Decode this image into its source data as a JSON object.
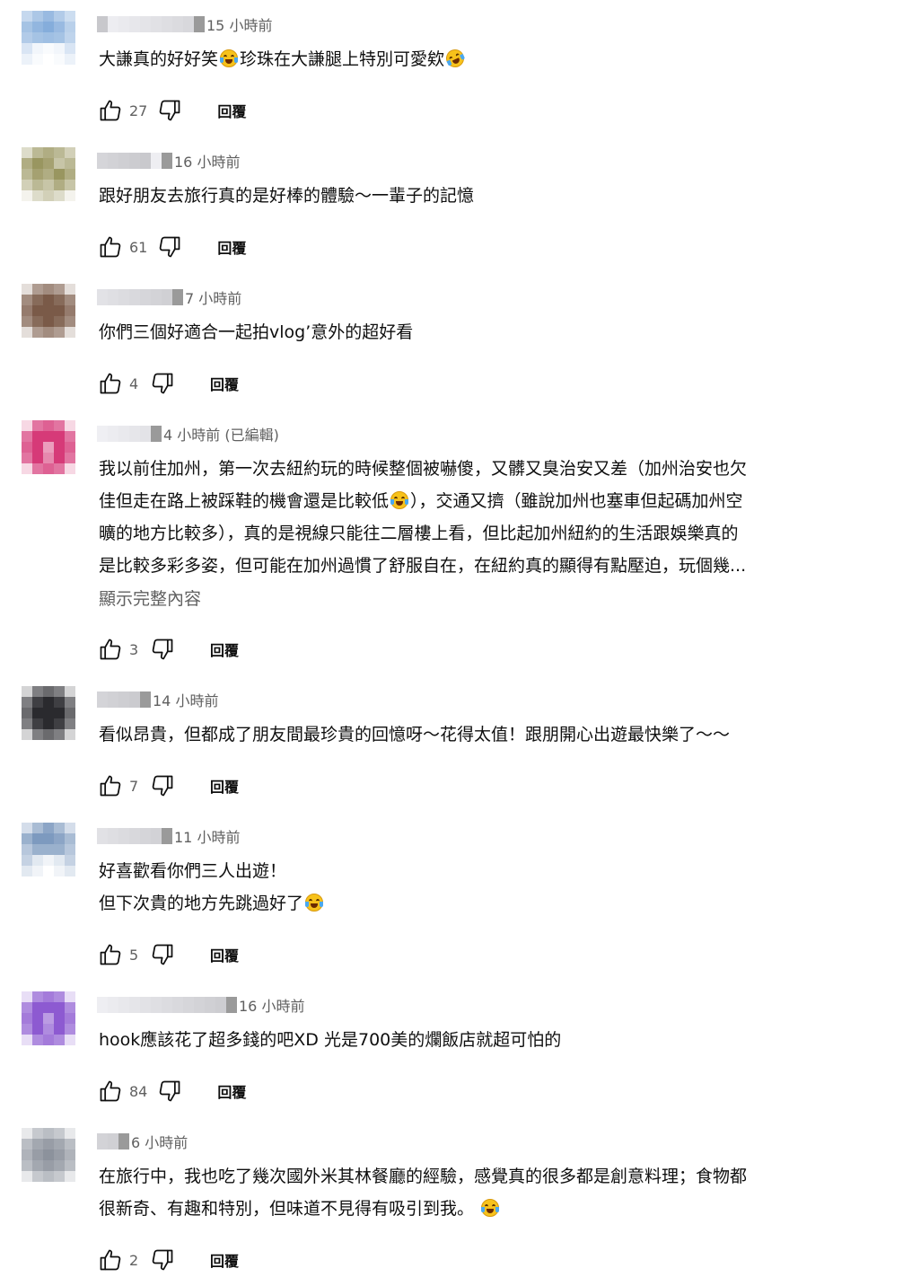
{
  "comments": [
    {
      "time": "15 小時前",
      "parts": [
        {
          "t": "text",
          "v": "大謙真的好好笑"
        },
        {
          "t": "emoji",
          "v": "joy"
        },
        {
          "t": "text",
          "v": "珍珠在大謙腿上特別可愛欸"
        },
        {
          "t": "emoji",
          "v": "rofl"
        }
      ],
      "likes": "27",
      "reply_label": "回覆"
    },
    {
      "time": "16 小時前",
      "parts": [
        {
          "t": "text",
          "v": "跟好朋友去旅行真的是好棒的體驗～一輩子的記憶"
        }
      ],
      "likes": "61",
      "reply_label": "回覆"
    },
    {
      "time": "7 小時前",
      "parts": [
        {
          "t": "text",
          "v": "你們三個好適合一起拍vlog’意外的超好看"
        }
      ],
      "likes": "4",
      "reply_label": "回覆"
    },
    {
      "time": "4 小時前 (已編輯)",
      "parts": [
        {
          "t": "text",
          "v": "我以前住加州，第一次去紐約玩的時候整個被嚇傻，又髒又臭治安又差（加州治安也欠\n佳但走在路上被踩鞋的機會還是比較低"
        },
        {
          "t": "emoji",
          "v": "joy"
        },
        {
          "t": "text",
          "v": "），交通又擠（雖說加州也塞車但起碼加州空\n曠的地方比較多），真的是視線只能往二層樓上看，但比起加州紐約的生活跟娛樂真的\n是比較多彩多姿，但可能在加州過慣了舒服自在，在紐約真的顯得有點壓迫，玩個幾..."
        }
      ],
      "show_more": "顯示完整內容",
      "likes": "3",
      "reply_label": "回覆"
    },
    {
      "time": "14 小時前",
      "parts": [
        {
          "t": "text",
          "v": "看似昂貴，但都成了朋友間最珍貴的回憶呀～花得太值！跟朋開心出遊最快樂了～～"
        }
      ],
      "likes": "7",
      "reply_label": "回覆"
    },
    {
      "time": "11 小時前",
      "parts": [
        {
          "t": "text",
          "v": "好喜歡看你們三人出遊！\n但下次貴的地方先跳過好了"
        },
        {
          "t": "emoji",
          "v": "joy"
        }
      ],
      "likes": "5",
      "reply_label": "回覆"
    },
    {
      "time": "16 小時前",
      "parts": [
        {
          "t": "text",
          "v": "hook應該花了超多錢的吧XD 光是700美的爛飯店就超可怕的"
        }
      ],
      "likes": "84",
      "reply_label": "回覆"
    },
    {
      "time": "6 小時前",
      "parts": [
        {
          "t": "text",
          "v": "在旅行中，我也吃了幾次國外米其林餐廳的經驗，感覺真的很多都是創意料理；食物都\n很新奇、有趣和特別，但味道不見得有吸引到我。 "
        },
        {
          "t": "emoji",
          "v": "joy"
        }
      ],
      "likes": "2",
      "reply_label": "回覆"
    }
  ],
  "colors": {
    "text": "#0f0f0f",
    "secondary": "#606060",
    "avatar_1": "#7fa9d9",
    "avatar_2": "#8e8a4e",
    "avatar_3": "#7a5a48",
    "avatar_4": "#d63a78",
    "avatar_5": "#2a2a2e",
    "avatar_6": "#6f8fb8",
    "avatar_7": "#8d5ad1",
    "avatar_8": "#8c929c"
  },
  "icons": [
    "thumbs-up-icon",
    "thumbs-down-icon",
    "emoji-joy-icon",
    "emoji-rofl-icon"
  ]
}
